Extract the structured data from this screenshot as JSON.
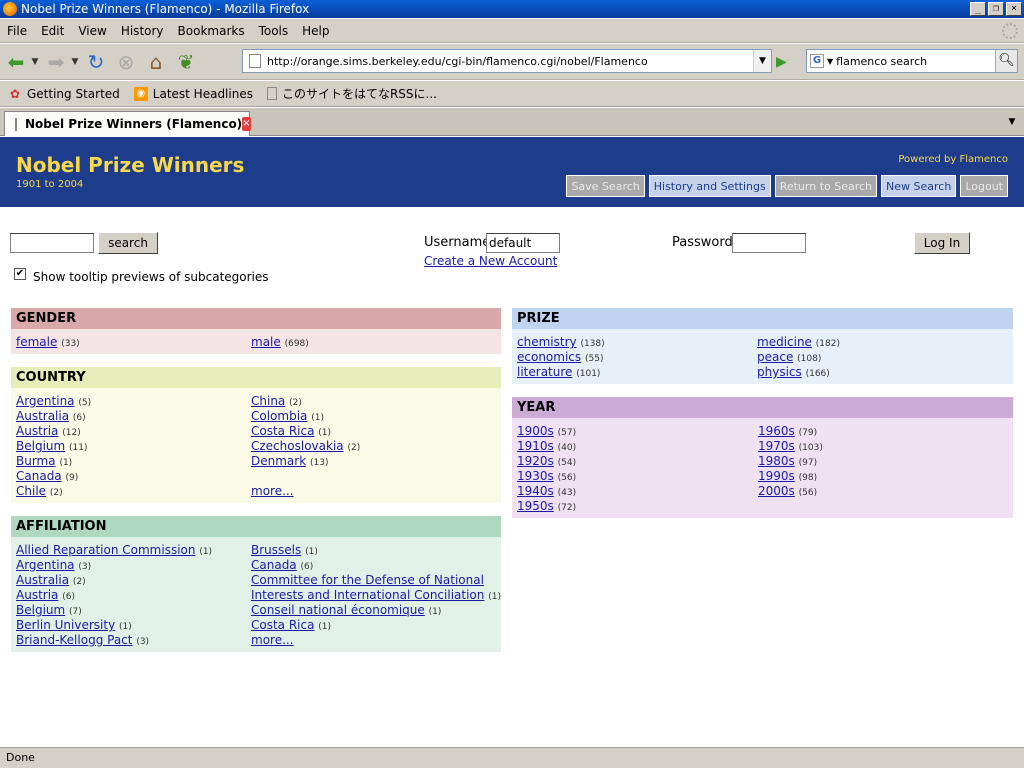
{
  "window": {
    "title": "Nobel Prize Winners (Flamenco) - Mozilla Firefox"
  },
  "menu": [
    "File",
    "Edit",
    "View",
    "History",
    "Bookmarks",
    "Tools",
    "Help"
  ],
  "nav": {
    "url": "http://orange.sims.berkeley.edu/cgi-bin/flamenco.cgi/nobel/Flamenco",
    "search_engine_icon": "G",
    "search_text": "flamenco search"
  },
  "bookmarks": [
    "Getting Started",
    "Latest Headlines",
    "このサイトをはてなRSSに..."
  ],
  "tab": {
    "label": "Nobel Prize Winners (Flamenco)"
  },
  "header": {
    "title": "Nobel Prize Winners",
    "subtitle": "1901 to 2004",
    "powered": "Powered by Flamenco",
    "buttons": [
      {
        "label": "Save Search",
        "enabled": false
      },
      {
        "label": "History and Settings",
        "enabled": true
      },
      {
        "label": "Return to Search",
        "enabled": false
      },
      {
        "label": "New Search",
        "enabled": true
      },
      {
        "label": "Logout",
        "enabled": false
      }
    ]
  },
  "search": {
    "button": "search",
    "tooltip_label": "Show tooltip previews of subcategories",
    "tooltip_checked": "✔"
  },
  "login": {
    "username_label": "Username",
    "username_value": "default",
    "create_account": "Create a New Account",
    "password_label": "Password",
    "login_button": "Log In"
  },
  "facets": {
    "gender": {
      "title": "GENDER",
      "col1": [
        {
          "label": "female",
          "count": "(33)"
        }
      ],
      "col2": [
        {
          "label": "male",
          "count": "(698)"
        }
      ]
    },
    "country": {
      "title": "COUNTRY",
      "col1": [
        {
          "label": "Argentina",
          "count": "(5)"
        },
        {
          "label": "Australia",
          "count": "(6)"
        },
        {
          "label": "Austria",
          "count": "(12)"
        },
        {
          "label": "Belgium",
          "count": "(11)"
        },
        {
          "label": "Burma",
          "count": "(1)"
        },
        {
          "label": "Canada",
          "count": "(9)"
        },
        {
          "label": "Chile",
          "count": "(2)"
        }
      ],
      "col2": [
        {
          "label": "China",
          "count": "(2)"
        },
        {
          "label": "Colombia",
          "count": "(1)"
        },
        {
          "label": "Costa Rica",
          "count": "(1)"
        },
        {
          "label": "Czechoslovakia",
          "count": "(2)"
        },
        {
          "label": "Denmark",
          "count": "(13)"
        },
        {
          "label": "Canada",
          "count": "",
          "hidden": true
        },
        {
          "label": "more...",
          "count": ""
        }
      ]
    },
    "affiliation": {
      "title": "AFFILIATION",
      "col1": [
        {
          "label": "Allied Reparation Commission",
          "count": "(1)"
        },
        {
          "label": "Argentina",
          "count": "(3)"
        },
        {
          "label": "Australia",
          "count": "(2)"
        },
        {
          "label": "Austria",
          "count": "(6)"
        },
        {
          "label": "Belgium",
          "count": "(7)"
        },
        {
          "label": "Berlin University",
          "count": "(1)"
        },
        {
          "label": "Briand-Kellogg Pact",
          "count": "(3)"
        }
      ],
      "col2": [
        {
          "label": "Brussels",
          "count": "(1)"
        },
        {
          "label": "Canada",
          "count": "(6)"
        },
        {
          "label": "Committee for the Defense of National",
          "count": ""
        },
        {
          "label": "Interests and International Conciliation",
          "count": "(1)"
        },
        {
          "label": "Conseil national économique",
          "count": "(1)"
        },
        {
          "label": "Costa Rica",
          "count": "(1)"
        },
        {
          "label": "more...",
          "count": ""
        }
      ]
    },
    "prize": {
      "title": "PRIZE",
      "col1": [
        {
          "label": "chemistry",
          "count": "(138)"
        },
        {
          "label": "economics",
          "count": "(55)"
        },
        {
          "label": "literature",
          "count": "(101)"
        }
      ],
      "col2": [
        {
          "label": "medicine",
          "count": "(182)"
        },
        {
          "label": "peace",
          "count": "(108)"
        },
        {
          "label": "physics",
          "count": "(166)"
        }
      ]
    },
    "year": {
      "title": "YEAR",
      "col1": [
        {
          "label": "1900s",
          "count": "(57)"
        },
        {
          "label": "1910s",
          "count": "(40)"
        },
        {
          "label": "1920s",
          "count": "(54)"
        },
        {
          "label": "1930s",
          "count": "(56)"
        },
        {
          "label": "1940s",
          "count": "(43)"
        },
        {
          "label": "1950s",
          "count": "(72)"
        }
      ],
      "col2": [
        {
          "label": "1960s",
          "count": "(79)"
        },
        {
          "label": "1970s",
          "count": "(103)"
        },
        {
          "label": "1980s",
          "count": "(97)"
        },
        {
          "label": "1990s",
          "count": "(98)"
        },
        {
          "label": "2000s",
          "count": "(56)"
        }
      ]
    }
  },
  "status": "Done"
}
